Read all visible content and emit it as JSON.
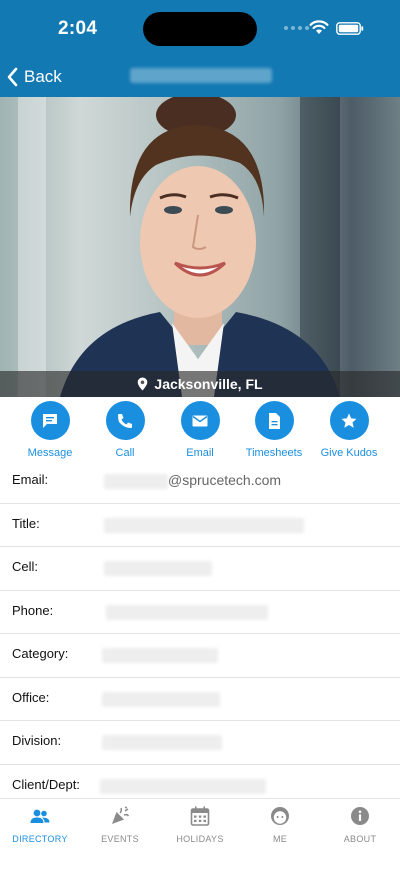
{
  "status_bar": {
    "time": "2:04"
  },
  "nav": {
    "back_label": "Back"
  },
  "profile": {
    "location": "Jacksonville, FL"
  },
  "actions": [
    {
      "label": "Message",
      "icon": "message-icon"
    },
    {
      "label": "Call",
      "icon": "phone-icon"
    },
    {
      "label": "Email",
      "icon": "envelope-icon"
    },
    {
      "label": "Timesheets",
      "icon": "document-icon"
    },
    {
      "label": "Give Kudos",
      "icon": "star-icon"
    }
  ],
  "details": {
    "email_label": "Email:",
    "email_domain": "@sprucetech.com",
    "title_label": "Title:",
    "cell_label": "Cell:",
    "phone_label": "Phone:",
    "category_label": "Category:",
    "office_label": "Office:",
    "division_label": "Division:",
    "client_label": "Client/Dept:"
  },
  "tabs": [
    {
      "label": "DIRECTORY",
      "icon": "people-icon",
      "active": true
    },
    {
      "label": "EVENTS",
      "icon": "party-popper-icon",
      "active": false
    },
    {
      "label": "HOLIDAYS",
      "icon": "calendar-icon",
      "active": false
    },
    {
      "label": "ME",
      "icon": "face-icon",
      "active": false
    },
    {
      "label": "ABOUT",
      "icon": "info-icon",
      "active": false
    }
  ],
  "colors": {
    "brand": "#1379b3",
    "accent": "#1a8fe0",
    "inactive": "#8a8a8a"
  }
}
